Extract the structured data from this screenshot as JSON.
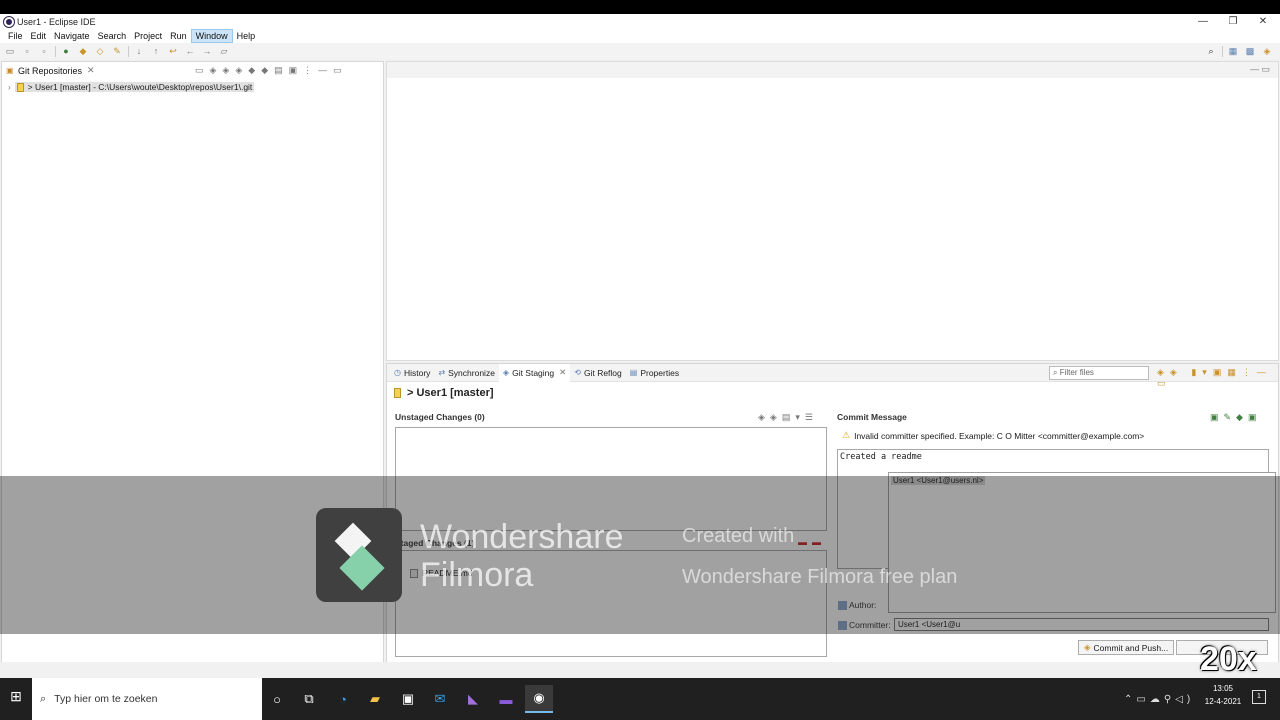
{
  "window": {
    "title": "User1 - Eclipse IDE",
    "controls": [
      "—",
      "❐",
      "✕"
    ]
  },
  "menu": [
    "File",
    "Edit",
    "Navigate",
    "Search",
    "Project",
    "Run",
    "Window",
    "Help"
  ],
  "left_view": {
    "tab_label": "Git Repositories",
    "repo_entry": "> User1 [master] - C:\\Users\\woute\\Desktop\\repos\\User1\\.git"
  },
  "bottom_tabs": [
    {
      "label": "History",
      "icon": "history-icon"
    },
    {
      "label": "Synchronize",
      "icon": "sync-icon"
    },
    {
      "label": "Git Staging",
      "icon": "staging-icon"
    },
    {
      "label": "Git Reflog",
      "icon": "reflog-icon"
    },
    {
      "label": "Properties",
      "icon": "properties-icon"
    }
  ],
  "filter_placeholder": "Filter files",
  "staging": {
    "repo_header": "> User1 [master]",
    "unstaged_label": "Unstaged Changes (0)",
    "staged_label": "Staged Changes (1)",
    "staged_files": [
      "README.md"
    ],
    "commit_message_label": "Commit Message",
    "warning": "Invalid committer specified. Example: C O Mitter <committer@example.com>",
    "commit_message": "Created a readme",
    "author_label": "Author:",
    "committer_label": "Committer:",
    "committer_value": "User1 <User1@u",
    "autocomplete_option": "User1 <User1@users.nl>",
    "commit_push_label": "Commit and Push..."
  },
  "watermark": {
    "brand_line1": "Wondershare",
    "brand_line2": "Filmora",
    "created_with": "Created with",
    "plan": "Wondershare Filmora free plan",
    "speed": "20x"
  },
  "taskbar": {
    "search_placeholder": "Typ hier om te zoeken",
    "time": "13:05",
    "date": "12-4-2021",
    "notification_count": "1"
  }
}
